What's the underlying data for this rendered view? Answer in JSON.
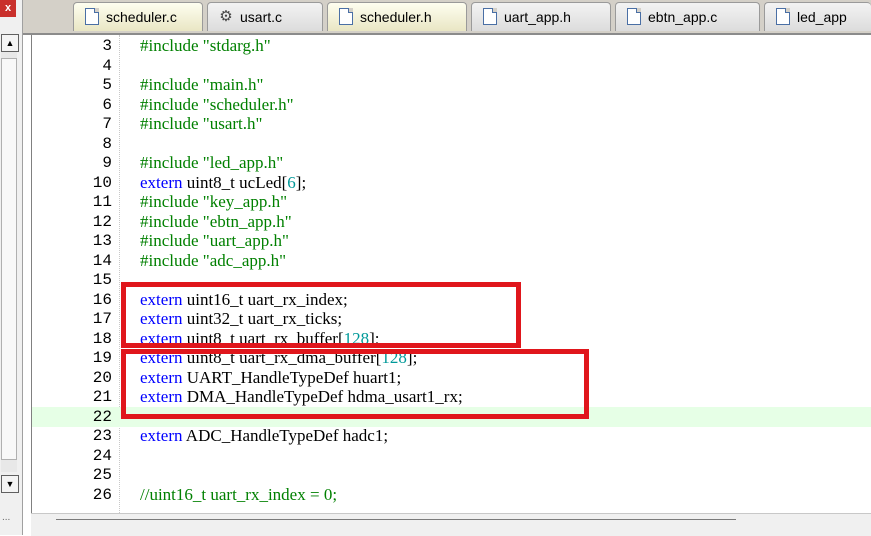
{
  "left_pane": {
    "close_glyph": "x",
    "dots": "..."
  },
  "tabs": [
    {
      "label": "scheduler.c",
      "icon": "file-icon",
      "active": true
    },
    {
      "label": "usart.c",
      "icon": "gear-file-icon",
      "active": false
    },
    {
      "label": "scheduler.h",
      "icon": "file-icon",
      "active": true
    },
    {
      "label": "uart_app.h",
      "icon": "file-icon",
      "active": false
    },
    {
      "label": "ebtn_app.c",
      "icon": "file-icon",
      "active": false
    },
    {
      "label": "led_app",
      "icon": "file-icon",
      "active": false
    }
  ],
  "code_lines": [
    {
      "num": "3",
      "tokens": [
        [
          "pp",
          "#include "
        ],
        [
          "str",
          "\"stdarg.h\""
        ]
      ]
    },
    {
      "num": "4",
      "tokens": []
    },
    {
      "num": "5",
      "tokens": [
        [
          "pp",
          "#include "
        ],
        [
          "str",
          "\"main.h\""
        ]
      ]
    },
    {
      "num": "6",
      "tokens": [
        [
          "pp",
          "#include "
        ],
        [
          "str",
          "\"scheduler.h\""
        ]
      ]
    },
    {
      "num": "7",
      "tokens": [
        [
          "pp",
          "#include "
        ],
        [
          "str",
          "\"usart.h\""
        ]
      ]
    },
    {
      "num": "8",
      "tokens": []
    },
    {
      "num": "9",
      "tokens": [
        [
          "pp",
          "#include "
        ],
        [
          "str",
          "\"led_app.h\""
        ]
      ]
    },
    {
      "num": "10",
      "tokens": [
        [
          "kw",
          "extern"
        ],
        [
          "txt",
          " uint8_t ucLed["
        ],
        [
          "num",
          "6"
        ],
        [
          "txt",
          "];"
        ]
      ]
    },
    {
      "num": "11",
      "tokens": [
        [
          "pp",
          "#include "
        ],
        [
          "str",
          "\"key_app.h\""
        ]
      ]
    },
    {
      "num": "12",
      "tokens": [
        [
          "pp",
          "#include "
        ],
        [
          "str",
          "\"ebtn_app.h\""
        ]
      ]
    },
    {
      "num": "13",
      "tokens": [
        [
          "pp",
          "#include "
        ],
        [
          "str",
          "\"uart_app.h\""
        ]
      ]
    },
    {
      "num": "14",
      "tokens": [
        [
          "pp",
          "#include "
        ],
        [
          "str",
          "\"adc_app.h\""
        ]
      ]
    },
    {
      "num": "15",
      "tokens": []
    },
    {
      "num": "16",
      "tokens": [
        [
          "kw",
          "extern"
        ],
        [
          "txt",
          " uint16_t uart_rx_index;"
        ]
      ]
    },
    {
      "num": "17",
      "tokens": [
        [
          "kw",
          "extern"
        ],
        [
          "txt",
          " uint32_t uart_rx_ticks;"
        ]
      ]
    },
    {
      "num": "18",
      "tokens": [
        [
          "kw",
          "extern"
        ],
        [
          "txt",
          " uint8_t uart_rx_buffer["
        ],
        [
          "num",
          "128"
        ],
        [
          "txt",
          "];"
        ]
      ]
    },
    {
      "num": "19",
      "tokens": [
        [
          "kw",
          "extern"
        ],
        [
          "txt",
          " uint8_t uart_rx_dma_buffer["
        ],
        [
          "num",
          "128"
        ],
        [
          "txt",
          "];"
        ]
      ]
    },
    {
      "num": "20",
      "tokens": [
        [
          "kw",
          "extern"
        ],
        [
          "txt",
          " UART_HandleTypeDef huart1;"
        ]
      ]
    },
    {
      "num": "21",
      "tokens": [
        [
          "kw",
          "extern"
        ],
        [
          "txt",
          " DMA_HandleTypeDef hdma_usart1_rx;"
        ]
      ]
    },
    {
      "num": "22",
      "tokens": [],
      "highlight": true
    },
    {
      "num": "23",
      "tokens": [
        [
          "kw",
          "extern"
        ],
        [
          "txt",
          " ADC_HandleTypeDef hadc1;"
        ]
      ]
    },
    {
      "num": "24",
      "tokens": []
    },
    {
      "num": "25",
      "tokens": []
    },
    {
      "num": "26",
      "tokens": [
        [
          "cm",
          "//uint16_t uart_rx_index = 0;"
        ]
      ]
    }
  ],
  "colors": {
    "keyword": "#0000ff",
    "preprocessor": "#008000",
    "number": "#009999",
    "highlight_box": "#e0161c",
    "current_line": "#e6ffe6"
  }
}
